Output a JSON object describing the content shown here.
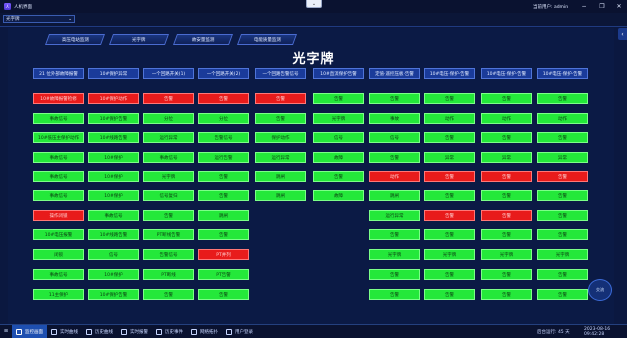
{
  "titlebar": {
    "app_icon": "人",
    "app_title": "人机界面",
    "center_button": "⌄",
    "user_label": "当前用户: admin",
    "minimize": "−",
    "maximize": "❐",
    "close": "✕"
  },
  "toolbar": {
    "selector_value": "光字牌",
    "selector_arrow": "⌄"
  },
  "nav": {
    "tabs": [
      "高压电站监测",
      "光字牌",
      "故安量监测",
      "电能质量监测"
    ]
  },
  "page_title": "光字牌",
  "side_button": "‹",
  "widget_text": "交流",
  "colors": {
    "green": "#24e83a",
    "red": "#e81b1b",
    "header": "#1a3b9a",
    "background": "#0b1840"
  },
  "grid": {
    "columns": [
      [
        "21 位外部故障报警",
        "10#故障报警检修",
        "事故信号",
        "10#低压主保护动作",
        "事故信号",
        "事故信号",
        "事故信号",
        "操作闭锁",
        "10#电压报警",
        "闭锁",
        "事故信号",
        "11主保护"
      ],
      [
        "10#保护异常",
        "10#保护动作",
        "10#保护告警",
        "10#线路告警",
        "10#保护",
        "10#保护",
        "10#保护",
        "事故信号",
        "10#线路告警",
        "信号",
        "10#保护",
        "10#保护告警"
      ],
      [
        "一个回路开关(1)",
        "告警",
        "分位",
        "运行异常",
        "事故信号",
        "光字牌",
        "信号复归",
        "告警",
        "PT断线告警",
        "告警信号",
        "PT断线",
        "告警"
      ],
      [
        "一个回路开关(2)",
        "告警",
        "分位",
        "告警信号",
        "运行告警",
        "告警",
        "告警",
        "跳闸",
        "告警",
        "PT并列",
        "PT告警",
        "告警"
      ],
      [
        "一个回路告警信号",
        "告警",
        "告警",
        "保护动作",
        "运行异常",
        "跳闸",
        "跳闸",
        "跳闸",
        "跳闸",
        "",
        "",
        ""
      ],
      [
        "10#直流保护告警",
        "告警",
        "光字牌",
        "信号",
        "故障",
        "告警",
        "故障",
        "",
        "",
        "",
        "",
        ""
      ],
      [
        "定值·遥控压板·告警",
        "告警",
        "事故",
        "信号",
        "告警",
        "动作",
        "跳闸",
        "运行异常",
        "告警",
        "光字牌",
        "告警",
        "告警"
      ],
      [
        "10#电压·保护·告警",
        "告警",
        "动作",
        "告警",
        "异常",
        "告警",
        "告警",
        "告警",
        "告警",
        "光字牌",
        "告警",
        "告警"
      ],
      [
        "10#电压·保护·告警",
        "告警",
        "动作",
        "告警",
        "异常",
        "告警",
        "告警",
        "告警",
        "告警",
        "光字牌",
        "告警",
        "告警"
      ],
      [
        "10#电压·保护·告警",
        "告警",
        "动作",
        "告警",
        "异常",
        "告警",
        "告警",
        "告警",
        "告警",
        "光字牌",
        "告警",
        "告警"
      ]
    ],
    "states": [
      [
        "h",
        "r",
        "g",
        "g",
        "g",
        "g",
        "g",
        "r",
        "g",
        "g",
        "g",
        "g"
      ],
      [
        "h",
        "r",
        "g",
        "g",
        "g",
        "g",
        "g",
        "g",
        "g",
        "g",
        "g",
        "g"
      ],
      [
        "h",
        "r",
        "g",
        "g",
        "g",
        "g",
        "g",
        "g",
        "g",
        "g",
        "g",
        "g"
      ],
      [
        "h",
        "r",
        "g",
        "g",
        "g",
        "g",
        "g",
        "g",
        "g",
        "r",
        "g",
        "g"
      ],
      [
        "h",
        "r",
        "g",
        "g",
        "g",
        "g",
        "g",
        "",
        "",
        "",
        "",
        ""
      ],
      [
        "h",
        "g",
        "g",
        "g",
        "g",
        "g",
        "g",
        "",
        "",
        "",
        "",
        ""
      ],
      [
        "h",
        "g",
        "g",
        "g",
        "g",
        "r",
        "g",
        "g",
        "g",
        "g",
        "g",
        "g"
      ],
      [
        "h",
        "g",
        "g",
        "g",
        "g",
        "r",
        "g",
        "r",
        "g",
        "g",
        "g",
        "g"
      ],
      [
        "h",
        "g",
        "g",
        "g",
        "g",
        "r",
        "g",
        "r",
        "g",
        "g",
        "g",
        "g"
      ],
      [
        "h",
        "g",
        "g",
        "g",
        "g",
        "r",
        "g",
        "g",
        "g",
        "g",
        "g",
        "g"
      ]
    ]
  },
  "bottombar": {
    "start_icon": "⊞",
    "tabs": [
      "监控画面",
      "实时曲线",
      "历史曲线",
      "实时报警",
      "历史事件",
      "网络拓扑",
      "用户登录"
    ],
    "status_text": "后台运行: 45 天",
    "datetime": "2023-08-16 09:42:28"
  }
}
